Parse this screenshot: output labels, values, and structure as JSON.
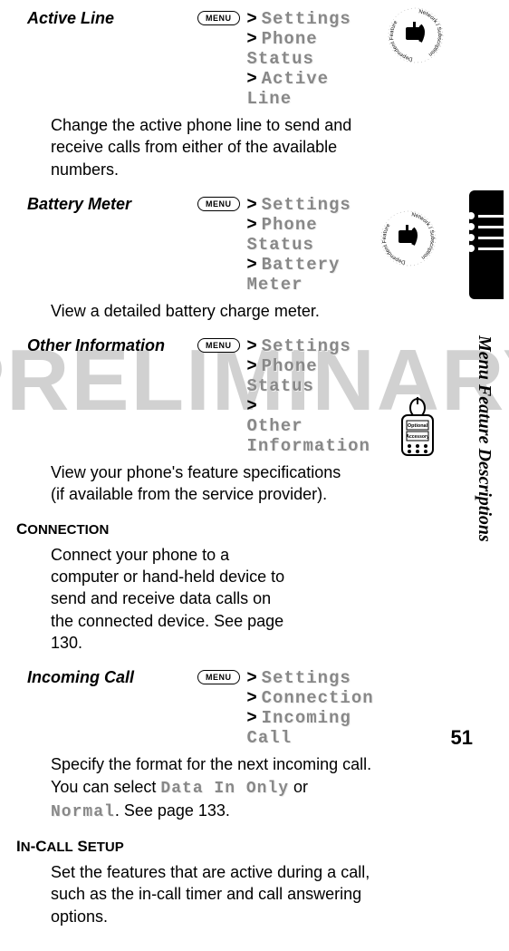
{
  "watermark": "PRELIMINARY",
  "side_label": "Menu Feature Descriptions",
  "page_number": "51",
  "menu_key_label": "MENU",
  "sections": {
    "active_line": {
      "title": "Active Line",
      "path1": "Settings",
      "path2": "Phone Status",
      "path3": "Active Line",
      "desc": "Change the active phone line to send and receive calls from either of the available numbers."
    },
    "battery_meter": {
      "title": "Battery Meter",
      "path1": "Settings",
      "path2": "Phone Status",
      "path3": "Battery Meter",
      "desc": "View a detailed battery charge meter."
    },
    "other_info": {
      "title": "Other Information",
      "path1": "Settings",
      "path2": "Phone Status",
      "path3": "Other Information",
      "desc1": "View your phone's feature specifications",
      "desc2": "(if available from the service provider)."
    },
    "connection": {
      "heading_first": "C",
      "heading_rest": "ONNECTION",
      "desc": "Connect your phone to a computer or hand-held device to send and receive data calls on the connected device. See page 130."
    },
    "incoming_call": {
      "title": "Incoming Call",
      "path1": "Settings",
      "path2": "Connection",
      "path3": "Incoming Call",
      "desc_a": "Specify the format for the next incoming call. You can select ",
      "opt1": "Data In Only",
      "desc_b": " or ",
      "opt2": "Normal",
      "desc_c": ". See page 133."
    },
    "incall": {
      "heading_a": "I",
      "heading_b": "N",
      "heading_c": "-C",
      "heading_d": "ALL",
      "heading_e": " S",
      "heading_f": "ETUP",
      "desc": "Set the features that are active during a call, such as the in-call timer and call answering options."
    }
  },
  "badges": {
    "network_sub": "Network / Subscription Dependent Feature",
    "optional_accessory": "Optional Accessory"
  }
}
